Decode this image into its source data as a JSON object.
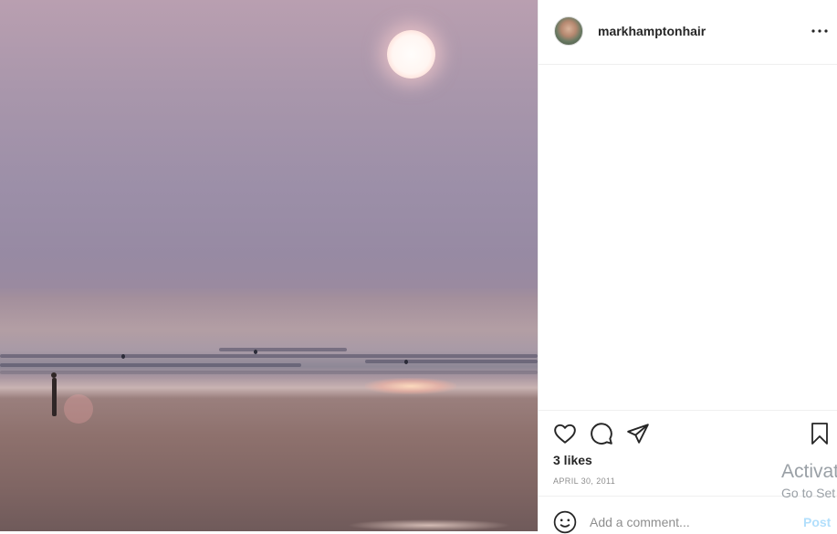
{
  "post": {
    "username": "markhamptonhair",
    "likes": "3 likes",
    "date": "APRIL 30, 2011"
  },
  "comment": {
    "placeholder": "Add a comment...",
    "post_label": "Post"
  },
  "watermark": {
    "line1": "Activat",
    "line2": "Go to Set"
  },
  "icons": {
    "avatar": "user-avatar",
    "more": "more-options-icon",
    "like": "heart-icon",
    "comment": "comment-bubble-icon",
    "share": "paper-plane-icon",
    "save": "bookmark-icon",
    "emoji": "smiley-icon"
  }
}
